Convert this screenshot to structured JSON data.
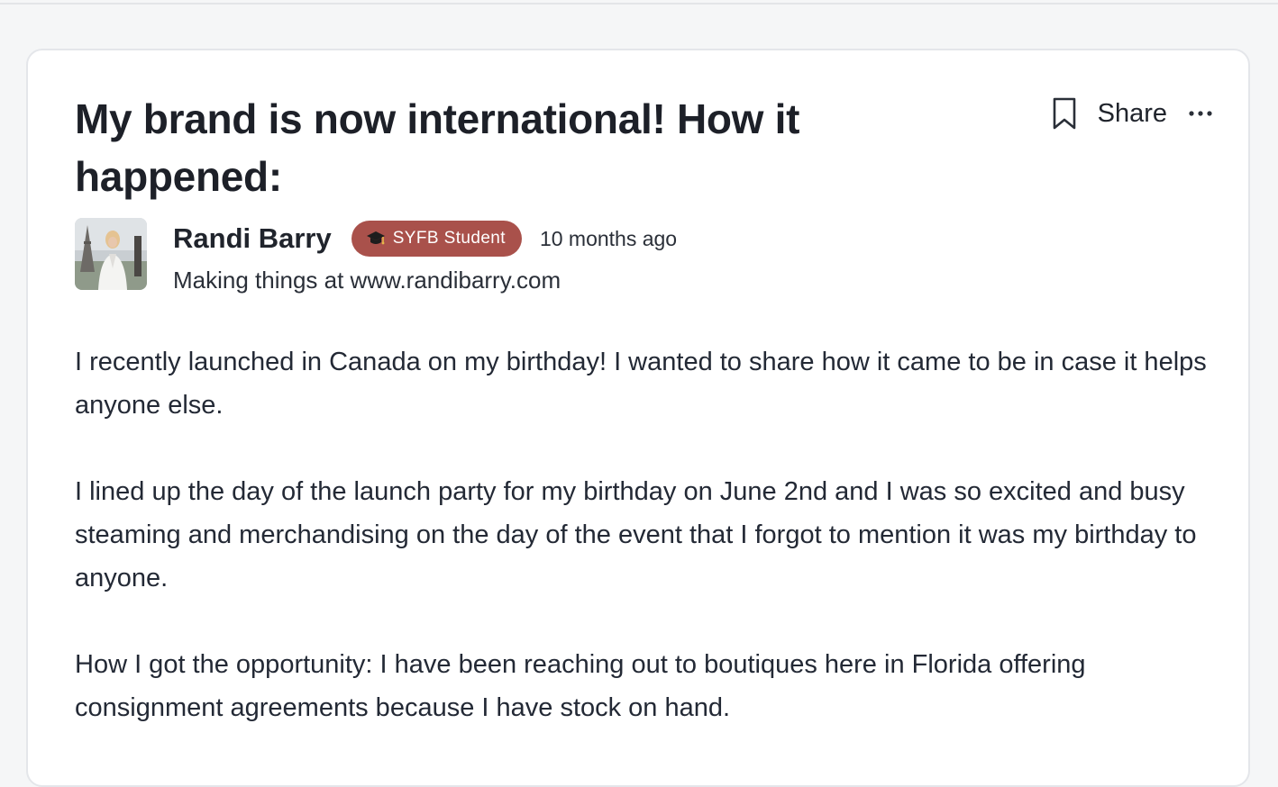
{
  "post": {
    "title": "My brand is now international! How it happened:",
    "actions": {
      "bookmark_icon": "bookmark-icon",
      "share_label": "Share",
      "more_icon": "more-horizontal-icon"
    },
    "author": {
      "name": "Randi Barry",
      "badge": {
        "icon": "graduation-cap-icon",
        "label": "SYFB Student",
        "color": "#a9514b"
      },
      "posted": "10 months ago",
      "tagline": "Making things at www.randibarry.com"
    },
    "paragraphs": [
      "I recently launched in Canada on my birthday! I wanted to share how it came to be in case it helps anyone else.",
      "I lined up the day of the launch party for my birthday on June 2nd and I was so excited and busy steaming and merchandising on the day of the event that I forgot to mention it was my birthday to anyone.",
      "How I got the opportunity: I have been reaching out to boutiques here in Florida offering consignment agreements because I have stock on hand."
    ]
  }
}
